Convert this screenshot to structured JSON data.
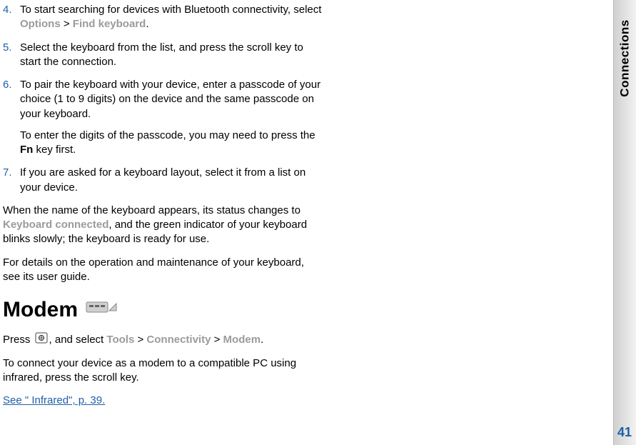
{
  "sideTab": {
    "label": "Connections",
    "pageNumber": "41"
  },
  "steps": [
    {
      "marker": "4.",
      "pre": "To start searching for devices with Bluetooth connectivity, select ",
      "hl1": "Options",
      "mid": " > ",
      "hl2": "Find keyboard",
      "post": "."
    },
    {
      "marker": "5.",
      "text": "Select the keyboard from the list, and press the scroll key to start the connection."
    },
    {
      "marker": "6.",
      "text": "To pair the keyboard with your device, enter a passcode of your choice (1 to 9 digits) on the device and the same passcode on your keyboard.",
      "sub_pre": "To enter the digits of the passcode, you may need to press the ",
      "sub_bold": "Fn",
      "sub_post": " key first."
    },
    {
      "marker": "7.",
      "text": "If you are asked for a keyboard layout, select it from a list on your device."
    }
  ],
  "afterSteps": {
    "p1_pre": "When the name of the keyboard appears, its status changes to ",
    "p1_hl": "Keyboard connected",
    "p1_post": ", and the green indicator of your keyboard blinks slowly; the keyboard is ready for use.",
    "p2": "For details on the operation and maintenance of your keyboard, see its user guide."
  },
  "modem": {
    "heading": "Modem",
    "press": "Press ",
    "afterIcon": ", and select ",
    "hl1": "Tools",
    "sep": " > ",
    "hl2": "Connectivity",
    "sep2": " > ",
    "hl3": "Modem",
    "post": ".",
    "p2": "To connect your device as a modem to a compatible PC using infrared, press the scroll key.",
    "link": "See \" Infrared\", p. 39."
  }
}
